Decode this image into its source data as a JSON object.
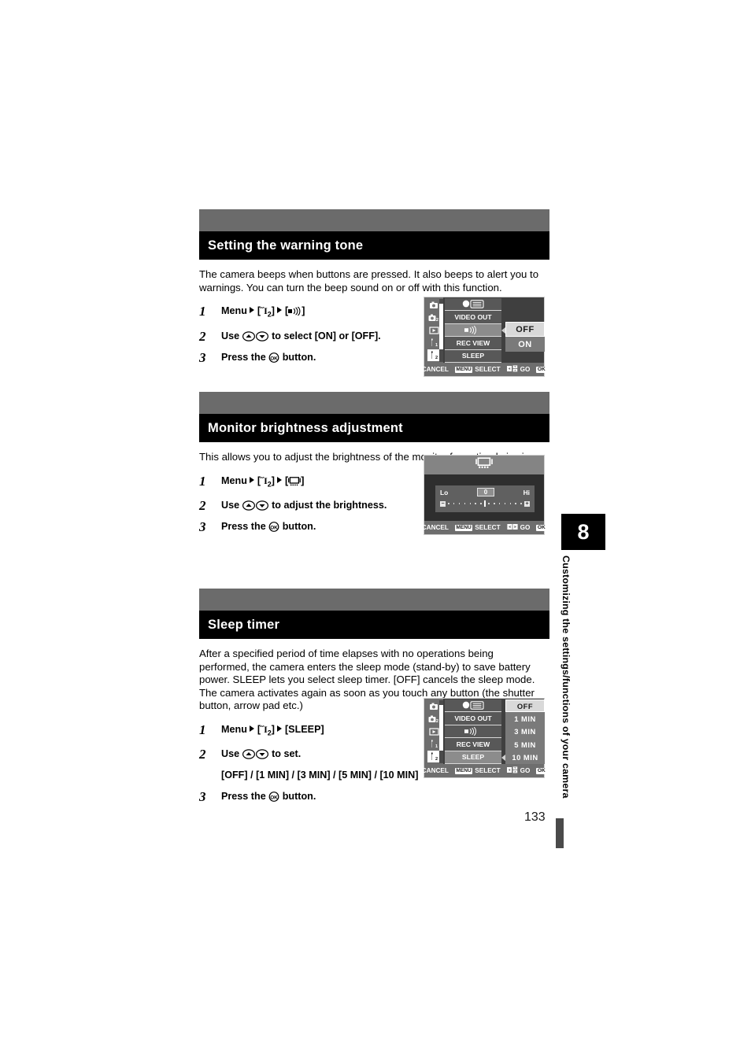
{
  "page": {
    "number": "133",
    "chapter_tab": "8",
    "chapter_text": "Customizing the settings/functions of your camera"
  },
  "sections": [
    {
      "title": "Setting the warning tone",
      "body": "The camera beeps when buttons are pressed. It also beeps to alert you to warnings. You can turn the beep sound on or off with this function.",
      "steps": [
        {
          "num": "1",
          "prefix": "Menu",
          "menu_tag": "2",
          "bracket_suffix": "",
          "text_after": ""
        },
        {
          "num": "2",
          "text": "Use   to select [ON] or [OFF].",
          "lead": "Use",
          "tail": "to select [ON] or [OFF]."
        },
        {
          "num": "3",
          "lead": "Press the",
          "tail": "button."
        }
      ]
    },
    {
      "title": "Monitor brightness adjustment",
      "body": "This allows you to adjust the brightness of the monitor for optimal viewing.",
      "steps": [
        {
          "num": "1",
          "prefix": "Menu",
          "menu_tag": "2"
        },
        {
          "num": "2",
          "lead": "Use",
          "tail": "to adjust the brightness."
        },
        {
          "num": "3",
          "lead": "Press the",
          "tail": "button."
        }
      ]
    },
    {
      "title": "Sleep timer",
      "body": "After a specified period of time elapses with no operations being performed, the camera enters the sleep mode (stand-by) to save battery power. SLEEP lets you select sleep timer. [OFF] cancels the sleep mode.\nThe camera activates again as soon as you touch any button (the shutter button, arrow pad etc.)",
      "steps": [
        {
          "num": "1",
          "prefix": "Menu",
          "menu_tag": "2",
          "bracket_label": "[SLEEP]"
        },
        {
          "num": "2",
          "lead": "Use",
          "tail": "to set.",
          "sub": "[OFF] / [1 MIN] / [3 MIN] / [5 MIN] / [10 MIN]"
        },
        {
          "num": "3",
          "lead": "Press the",
          "tail": "button."
        }
      ]
    }
  ],
  "lcd_screens": {
    "warning_tone": {
      "rail_icons": [
        "camera-1",
        "camera-2",
        "playback",
        "wrench-1",
        "wrench-2"
      ],
      "rail_active_index": 4,
      "menu_items": [
        "",
        "VIDEO OUT",
        "",
        "REC VIEW",
        "SLEEP"
      ],
      "menu_selected_index": 2,
      "values": [
        "OFF",
        "ON"
      ],
      "value_selected_index": 0,
      "bar": {
        "cancel": "CANCEL",
        "cancel_key": "MENU",
        "select": "SELECT",
        "go": "GO",
        "go_key": "OK"
      }
    },
    "brightness": {
      "low_label": "Lo",
      "high_label": "Hi",
      "value": "0",
      "minus": "−",
      "plus": "+",
      "bar": {
        "cancel": "CANCEL",
        "cancel_key": "MENU",
        "select": "SELECT",
        "go": "GO",
        "go_key": "OK"
      }
    },
    "sleep_timer": {
      "rail_icons": [
        "camera-1",
        "camera-2",
        "playback",
        "wrench-1",
        "wrench-2"
      ],
      "rail_active_index": 4,
      "menu_items": [
        "",
        "VIDEO OUT",
        "",
        "REC VIEW",
        "SLEEP"
      ],
      "menu_selected_index": 4,
      "values": [
        "OFF",
        "1 MIN",
        "3 MIN",
        "5 MIN",
        "10 MIN"
      ],
      "value_selected_index": 0,
      "bar": {
        "cancel": "CANCEL",
        "cancel_key": "MENU",
        "select": "SELECT",
        "go": "GO",
        "go_key": "OK"
      }
    }
  }
}
